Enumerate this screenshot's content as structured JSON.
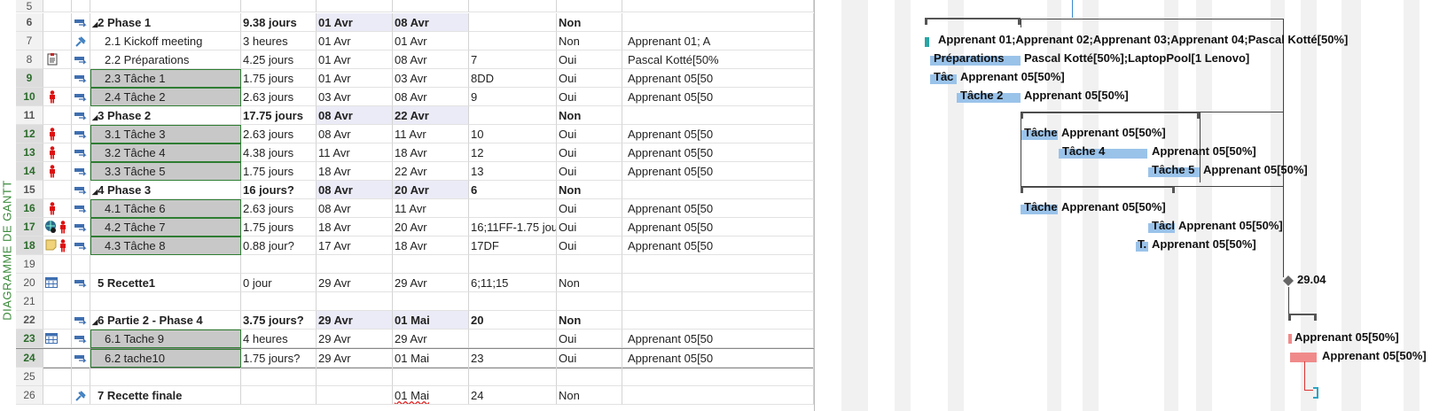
{
  "view_label": "DIAGRAMME DE GANTT",
  "colors": {
    "bar": "#9ac3ea",
    "critical_bar": "#f08a8a",
    "selection_outline": "#2e7d32",
    "row_number_selected": "#2a6b2a"
  },
  "rows": [
    {
      "n": "5",
      "name": "",
      "dur": "",
      "start": "",
      "end": "",
      "pred": "",
      "crit": "",
      "res": ""
    },
    {
      "n": "6",
      "name": "2 Phase 1",
      "dur": "9.38 jours",
      "start": "01 Avr",
      "end": "08 Avr",
      "pred": "",
      "crit": "Non",
      "res": ""
    },
    {
      "n": "7",
      "name": "2.1 Kickoff meeting",
      "dur": "3 heures",
      "start": "01 Avr",
      "end": "01 Avr",
      "pred": "",
      "crit": "Non",
      "res": "Apprenant 01;  A"
    },
    {
      "n": "8",
      "name": "2.2 Préparations",
      "dur": "4.25 jours",
      "start": "01 Avr",
      "end": "08 Avr",
      "pred": "7",
      "crit": "Oui",
      "res": "Pascal Kotté[50%"
    },
    {
      "n": "9",
      "name": "2.3 Tâche 1",
      "dur": "1.75 jours",
      "start": "01 Avr",
      "end": "03 Avr",
      "pred": "8DD",
      "crit": "Oui",
      "res": "Apprenant 05[50"
    },
    {
      "n": "10",
      "name": "2.4 Tâche 2",
      "dur": "2.63 jours",
      "start": "03 Avr",
      "end": "08 Avr",
      "pred": "9",
      "crit": "Oui",
      "res": "Apprenant 05[50"
    },
    {
      "n": "11",
      "name": "3 Phase 2",
      "dur": "17.75 jours",
      "start": "08 Avr",
      "end": "22 Avr",
      "pred": "",
      "crit": "Non",
      "res": ""
    },
    {
      "n": "12",
      "name": "3.1 Tâche 3",
      "dur": "2.63 jours",
      "start": "08 Avr",
      "end": "11 Avr",
      "pred": "10",
      "crit": "Oui",
      "res": "Apprenant 05[50"
    },
    {
      "n": "13",
      "name": "3.2 Tâche 4",
      "dur": "4.38 jours",
      "start": "11 Avr",
      "end": "18 Avr",
      "pred": "12",
      "crit": "Oui",
      "res": "Apprenant 05[50"
    },
    {
      "n": "14",
      "name": "3.3 Tâche 5",
      "dur": "1.75 jours",
      "start": "18 Avr",
      "end": "22 Avr",
      "pred": "13",
      "crit": "Oui",
      "res": "Apprenant 05[50"
    },
    {
      "n": "15",
      "name": "4 Phase 3",
      "dur": "16 jours?",
      "start": "08 Avr",
      "end": "20 Avr",
      "pred": "6",
      "crit": "Non",
      "res": ""
    },
    {
      "n": "16",
      "name": "4.1 Tâche 6",
      "dur": "2.63 jours",
      "start": "08 Avr",
      "end": "11 Avr",
      "pred": "",
      "crit": "Oui",
      "res": "Apprenant 05[50"
    },
    {
      "n": "17",
      "name": "4.2 Tâche 7",
      "dur": "1.75 jours",
      "start": "18 Avr",
      "end": "20 Avr",
      "pred": "16;11FF-1.75 jou",
      "crit": "Oui",
      "res": "Apprenant 05[50"
    },
    {
      "n": "18",
      "name": "4.3 Tâche 8",
      "dur": "0.88 jour?",
      "start": "17 Avr",
      "end": "18 Avr",
      "pred": "17DF",
      "crit": "Oui",
      "res": "Apprenant 05[50"
    },
    {
      "n": "19",
      "name": "",
      "dur": "",
      "start": "",
      "end": "",
      "pred": "",
      "crit": "",
      "res": ""
    },
    {
      "n": "20",
      "name": "5 Recette1",
      "dur": "0 jour",
      "start": "29 Avr",
      "end": "29 Avr",
      "pred": "6;11;15",
      "crit": "Non",
      "res": ""
    },
    {
      "n": "21",
      "name": "",
      "dur": "",
      "start": "",
      "end": "",
      "pred": "",
      "crit": "",
      "res": ""
    },
    {
      "n": "22",
      "name": "6 Partie 2 - Phase 4",
      "dur": "3.75 jours?",
      "start": "29 Avr",
      "end": "01 Mai",
      "pred": "20",
      "crit": "Non",
      "res": ""
    },
    {
      "n": "23",
      "name": "6.1 Tache 9",
      "dur": "4 heures",
      "start": "29 Avr",
      "end": "29 Avr",
      "pred": "",
      "crit": "Oui",
      "res": "Apprenant 05[50"
    },
    {
      "n": "24",
      "name": "6.2 tache10",
      "dur": "1.75 jours?",
      "start": "29 Avr",
      "end": "01 Mai",
      "pred": "23",
      "crit": "Oui",
      "res": "Apprenant 05[50"
    },
    {
      "n": "25",
      "name": "",
      "dur": "",
      "start": "",
      "end": "",
      "pred": "",
      "crit": "",
      "res": ""
    },
    {
      "n": "26",
      "name": "7 Recette finale",
      "dur": "",
      "start": "",
      "end": "01 Mai",
      "pred": "24",
      "crit": "Non",
      "res": ""
    }
  ],
  "gantt": {
    "labels": {
      "r7": "Apprenant 01;Apprenant 02;Apprenant 03;Apprenant 04;Pascal Kotté[50%]",
      "r8_bar": "Préparations",
      "r8": "Pascal Kotté[50%];LaptopPool[1 Lenovo]",
      "r9_bar": "Tâc",
      "r9": "Apprenant 05[50%]",
      "r10_bar": "Tâche 2",
      "r10": "Apprenant 05[50%]",
      "r12_bar": "Tâche",
      "r12": "Apprenant 05[50%]",
      "r13_bar": "Tâche 4",
      "r13": "Apprenant 05[50%]",
      "r14_bar": "Tâche 5",
      "r14": "Apprenant 05[50%]",
      "r16_bar": "Tâche",
      "r16": "Apprenant 05[50%]",
      "r17_bar": "Tâcl",
      "r17": "Apprenant 05[50%]",
      "r18_bar": "T.",
      "r18": "Apprenant 05[50%]",
      "r20": "29.04",
      "r23": "Apprenant 05[50%]",
      "r24": "Apprenant 05[50%]"
    }
  }
}
